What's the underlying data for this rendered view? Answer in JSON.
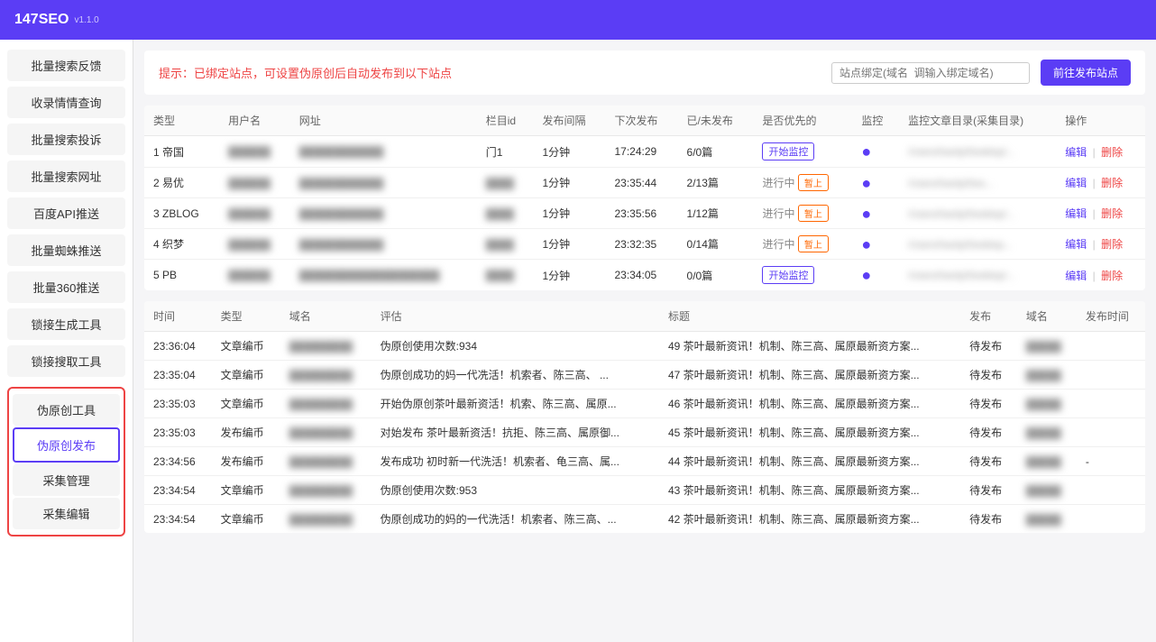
{
  "header": {
    "logo": "147SEO",
    "version": "v1.1.0"
  },
  "sidebar": {
    "items": [
      {
        "id": "feedback",
        "label": "批量搜索反馈"
      },
      {
        "id": "feedback-check",
        "label": "收录情情查询"
      },
      {
        "id": "complaint",
        "label": "批量搜索投诉"
      },
      {
        "id": "site",
        "label": "批量搜索网址"
      },
      {
        "id": "baidu-api",
        "label": "百度API推送"
      },
      {
        "id": "spider",
        "label": "批量蜘蛛推送"
      },
      {
        "id": "360",
        "label": "批量360推送"
      },
      {
        "id": "keygen",
        "label": "锁接生成工具"
      },
      {
        "id": "replace-tool",
        "label": "锁接搜取工具"
      }
    ],
    "group_items": [
      {
        "id": "content-tool",
        "label": "伪原创工具"
      },
      {
        "id": "fake-publish",
        "label": "伪原创发布",
        "active": true
      },
      {
        "id": "collect-manage",
        "label": "采集管理"
      },
      {
        "id": "collect-edit",
        "label": "采集编辑"
      }
    ]
  },
  "notice": {
    "text": "提示：已绑定站点，可设置伪原创后自动发布到以下站点",
    "input_placeholder": "站点绑定(域名  调输入绑定域名)",
    "button_label": "前往发布站点"
  },
  "upper_table": {
    "columns": [
      "类型",
      "用户名",
      "网址",
      "栏目id",
      "发布间隔",
      "下次发布",
      "已/未发布",
      "是否优先的",
      "监控",
      "监控文章目录(采集目录)",
      "操作"
    ],
    "rows": [
      {
        "id": 1,
        "type": "帝国",
        "username": "blurred1",
        "url": "blurred_url1",
        "category_id": "门1",
        "interval": "1分钟",
        "next_publish": "17:24:29",
        "published": "6/0篇",
        "priority": "开始监控",
        "priority_type": "outline",
        "monitor": "blue",
        "directory": "/Users/hardy/Desktop/...",
        "op_edit": "编辑",
        "op_delete": "删除"
      },
      {
        "id": 2,
        "type": "易优",
        "username": "blurred2",
        "url": "blurred_url2",
        "category_id": "blurred",
        "interval": "1分钟",
        "next_publish": "23:35:44",
        "published": "2/13篇",
        "priority": "进行中",
        "priority_type": "green",
        "priority2": "暂上",
        "monitor": "blue",
        "directory": "/Users/hardy/Des...",
        "op_edit": "编辑",
        "op_delete": "删除"
      },
      {
        "id": 3,
        "type": "ZBLOG",
        "username": "blurred3",
        "url": "blurred_url3",
        "category_id": "blurred",
        "interval": "1分钟",
        "next_publish": "23:35:56",
        "published": "1/12篇",
        "priority": "进行中",
        "priority_type": "green",
        "priority2": "暂上",
        "monitor": "blue",
        "directory": "/Users/hardy/Desktop/...",
        "op_edit": "编辑",
        "op_delete": "删除"
      },
      {
        "id": 4,
        "type": "织梦",
        "username": "blurred4",
        "url": "blurred_url4",
        "category_id": "blurred",
        "interval": "1分钟",
        "next_publish": "23:32:35",
        "published": "0/14篇",
        "priority": "进行中",
        "priority_type": "green",
        "priority2": "暂上",
        "monitor": "blue",
        "directory": "/Users/hardy/Desktop...",
        "op_edit": "编辑",
        "op_delete": "删除"
      },
      {
        "id": 5,
        "type": "PB",
        "username": "blurred5",
        "url": "blurred_url5",
        "category_id": "blurred",
        "interval": "1分钟",
        "next_publish": "23:34:05",
        "published": "0/0篇",
        "priority": "开始监控",
        "priority_type": "outline",
        "monitor": "blue",
        "directory": "/Users/hardy/Desktop/...",
        "op_edit": "编辑",
        "op_delete": "删除"
      }
    ]
  },
  "lower_table": {
    "columns": [
      "时间",
      "类型",
      "域名",
      "评估",
      "标题",
      "发布",
      "域名",
      "发布时间"
    ],
    "rows": [
      {
        "time": "23:36:04",
        "type": "文章编币",
        "domain": "blurred_d1",
        "evaluation": "伪原创使用次数:934",
        "title": "49 茶叶最新资讯！机制、陈三高、属原最新资方案...",
        "publish": "待发布",
        "pub_domain": "blurred",
        "pub_time": ""
      },
      {
        "time": "23:35:04",
        "type": "文章编币",
        "domain": "blurred_d2",
        "evaluation": "伪原创成功的妈一代冼活！机索者、陈三高、...",
        "title": "47 茶叶最新资讯！机制、陈三高、属原最新资方案...",
        "publish": "待发布",
        "pub_domain": "blurred",
        "pub_time": ""
      },
      {
        "time": "23:35:03",
        "type": "文章编币",
        "domain": "blurred_d3",
        "evaluation": "开始伪原创茶叶最新资活！机索、陈三高、属原...",
        "title": "46 茶叶最新资讯！机制、陈三高、属原最新资方案...",
        "publish": "待发布",
        "pub_domain": "blurred",
        "pub_time": ""
      },
      {
        "time": "23:35:03",
        "type": "发布编币",
        "domain": "blurred_d4",
        "evaluation": "对始发布 茶叶最新资活! 抗拒、陈三高、属原御...",
        "title": "45 茶叶最新资讯！机制、陈三高、属原最新资方案...",
        "publish": "待发布",
        "pub_domain": "blurred",
        "pub_time": ""
      },
      {
        "time": "23:34:56",
        "type": "发布编币",
        "domain": "blurred_d5",
        "evaluation": "发布成功 初时新一代洗活！机索者、龟三高、属...",
        "title": "44 茶叶最新资讯！机制、陈三高、属原最新资方案...",
        "publish": "待发布",
        "pub_domain": "blurred",
        "pub_time": "-"
      },
      {
        "time": "23:34:54",
        "type": "文章编币",
        "domain": "blurred_d6",
        "evaluation": "伪原创使用次数:953",
        "title": "43 茶叶最新资讯！机制、陈三高、属原最新资方案...",
        "publish": "待发布",
        "pub_domain": "blurred",
        "pub_time": ""
      },
      {
        "time": "23:34:54",
        "type": "文章编币",
        "domain": "blurred_d7",
        "evaluation": "伪原创成功的妈的一代洗活！机索者、陈三高、...",
        "title": "42 茶叶最新资讯！机制、陈三高、属原最新资方案...",
        "publish": "待发布",
        "pub_domain": "blurred",
        "pub_time": ""
      }
    ]
  }
}
